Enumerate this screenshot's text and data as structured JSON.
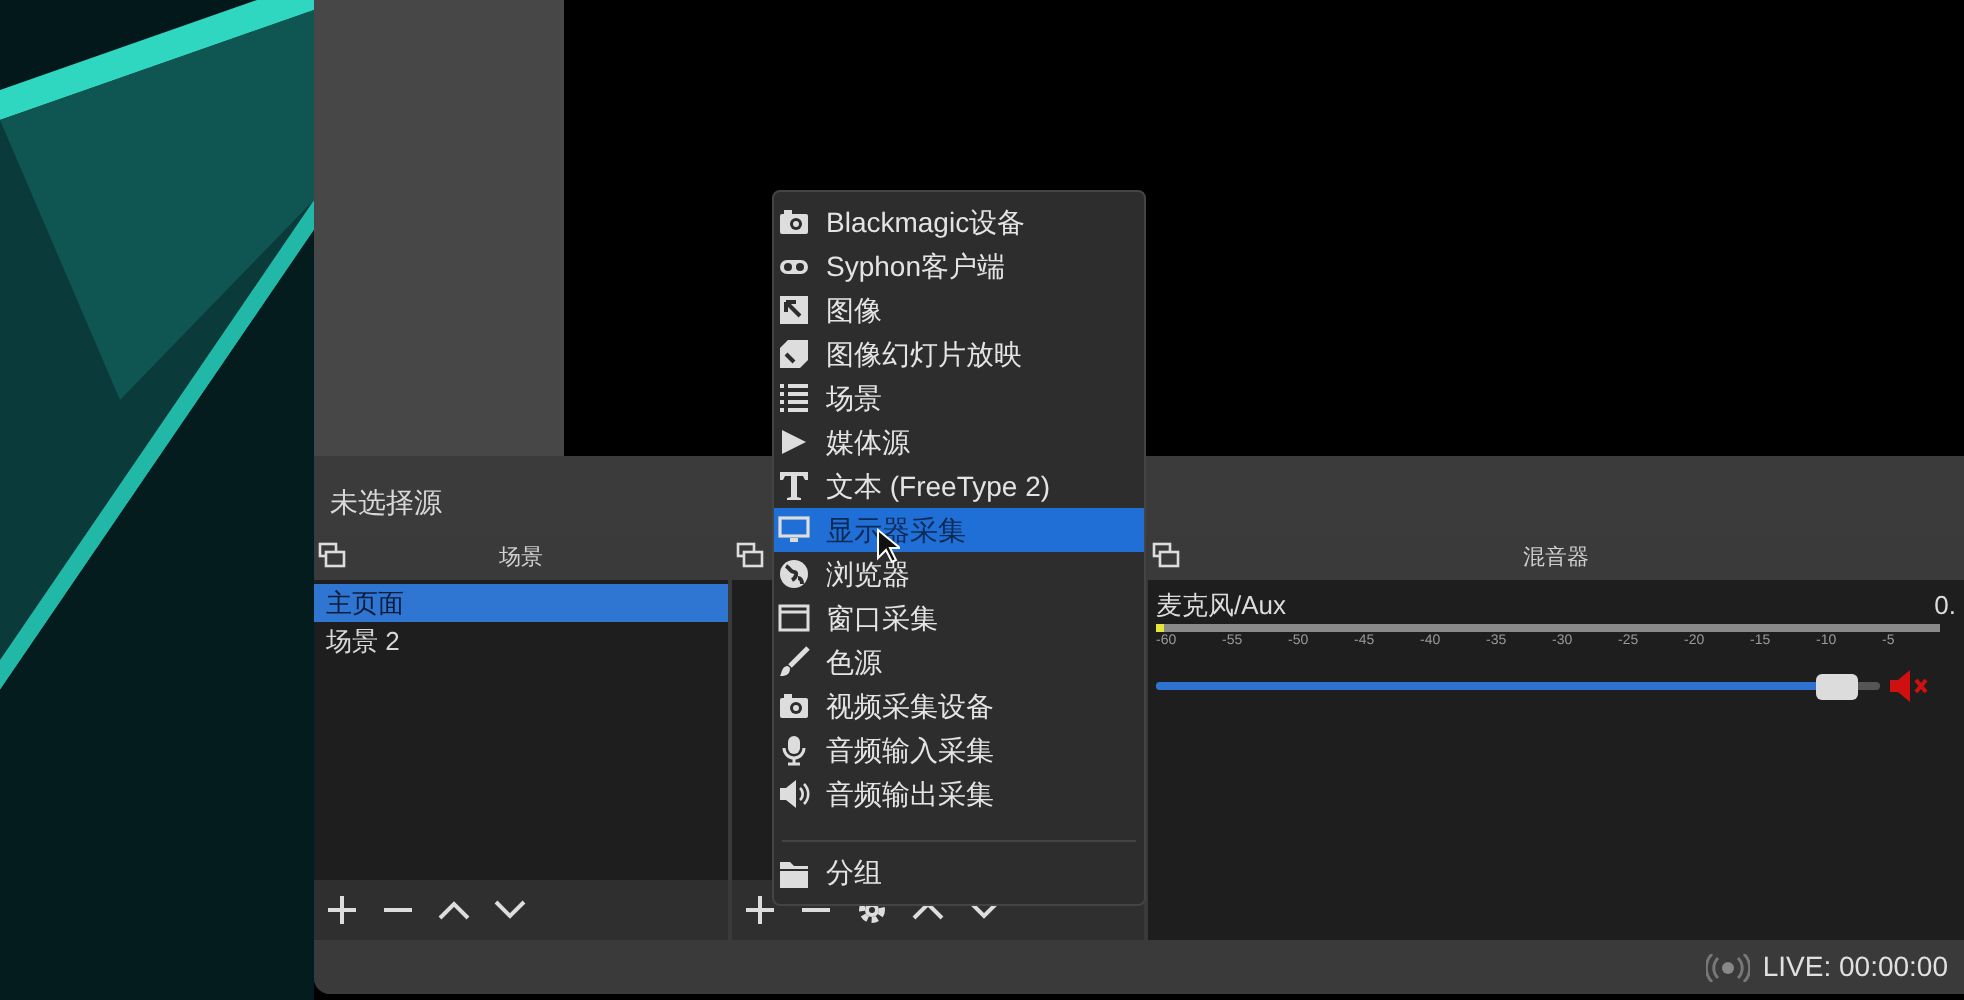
{
  "source_bar": {
    "label": "未选择源"
  },
  "scenes_dock": {
    "title": "场景",
    "items": [
      {
        "label": "主页面",
        "selected": true
      },
      {
        "label": "场景 2",
        "selected": false
      }
    ]
  },
  "mixer_dock": {
    "title": "混音器",
    "channels": [
      {
        "name": "麦克风/Aux",
        "reading": "0.",
        "ticks": [
          "-60",
          "-55",
          "-50",
          "-45",
          "-40",
          "-35",
          "-30",
          "-25",
          "-20",
          "-15",
          "-10",
          "-5"
        ],
        "level": 0.97,
        "muted": true
      }
    ]
  },
  "add_source_menu": {
    "items": [
      {
        "label": "Blackmagic设备",
        "kind": "source",
        "selected": false
      },
      {
        "label": "Syphon客户端",
        "kind": "source",
        "selected": false
      },
      {
        "label": "图像",
        "kind": "source",
        "selected": false
      },
      {
        "label": "图像幻灯片放映",
        "kind": "source",
        "selected": false
      },
      {
        "label": "场景",
        "kind": "source",
        "selected": false
      },
      {
        "label": "媒体源",
        "kind": "source",
        "selected": false
      },
      {
        "label": "文本 (FreeType 2)",
        "kind": "source",
        "selected": false
      },
      {
        "label": "显示器采集",
        "kind": "source",
        "selected": true
      },
      {
        "label": "浏览器",
        "kind": "source",
        "selected": false
      },
      {
        "label": "窗口采集",
        "kind": "source",
        "selected": false
      },
      {
        "label": "色源",
        "kind": "source",
        "selected": false
      },
      {
        "label": "视频采集设备",
        "kind": "source",
        "selected": false
      },
      {
        "label": "音频输入采集",
        "kind": "source",
        "selected": false
      },
      {
        "label": "音频输出采集",
        "kind": "source",
        "selected": false
      },
      {
        "label": "分组",
        "kind": "group",
        "selected": false
      }
    ]
  },
  "status_bar": {
    "live": "LIVE: 00:00:00"
  }
}
